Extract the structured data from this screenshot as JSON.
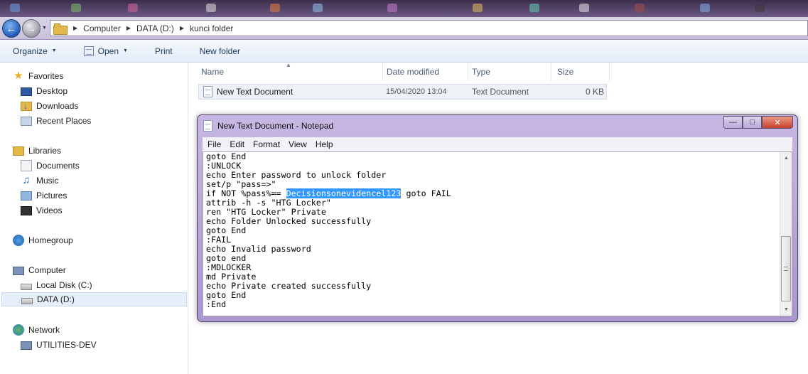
{
  "window": {
    "address": {
      "crumbs": [
        "Computer",
        "DATA (D:)",
        "kunci folder"
      ]
    },
    "toolbar": {
      "organize": "Organize",
      "open": "Open",
      "print": "Print",
      "new_folder": "New folder"
    }
  },
  "sidebar": {
    "favorites": {
      "label": "Favorites",
      "items": [
        "Desktop",
        "Downloads",
        "Recent Places"
      ]
    },
    "libraries": {
      "label": "Libraries",
      "items": [
        "Documents",
        "Music",
        "Pictures",
        "Videos"
      ]
    },
    "homegroup": "Homegroup",
    "computer": {
      "label": "Computer",
      "items": [
        "Local Disk (C:)",
        "DATA (D:)"
      ]
    },
    "network": {
      "label": "Network",
      "items": [
        "UTILITIES-DEV"
      ]
    }
  },
  "filelist": {
    "columns": [
      "Name",
      "Date modified",
      "Type",
      "Size"
    ],
    "rows": [
      {
        "name": "New Text Document",
        "date": "15/04/2020 13:04",
        "type": "Text Document",
        "size": "0 KB"
      }
    ]
  },
  "notepad": {
    "title": "New Text Document - Notepad",
    "menu": [
      "File",
      "Edit",
      "Format",
      "View",
      "Help"
    ],
    "content": {
      "lines_before": [
        "goto End",
        ":UNLOCK",
        "echo Enter password to unlock folder",
        "set/p \"pass=>\""
      ],
      "pw_line_pre": "if NOT %pass%== ",
      "pw_selected": "Decisionsonevidencel123",
      "pw_line_post": " goto FAIL",
      "lines_after": [
        "attrib -h -s \"HTG Locker\"",
        "ren \"HTG Locker\" Private",
        "echo Folder Unlocked successfully",
        "goto End",
        ":FAIL",
        "echo Invalid password",
        "goto end",
        ":MDLOCKER",
        "md Private",
        "echo Private created successfully",
        "goto End",
        ":End"
      ]
    }
  },
  "colors": {
    "selection": "#3399ff",
    "title_bar": "#b9a9d9",
    "close_button": "#c7412b"
  }
}
